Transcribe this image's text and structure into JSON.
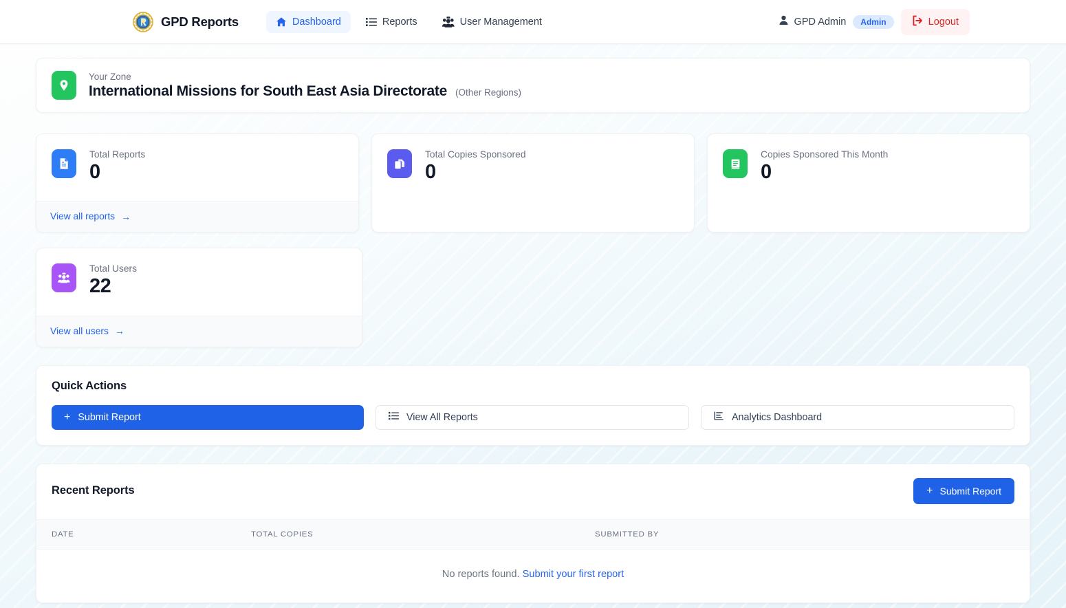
{
  "header": {
    "brand": "GPD Reports",
    "logo_icon": "gpd-emblem-logo",
    "nav": [
      {
        "label": "Dashboard",
        "icon": "home-icon",
        "active": true
      },
      {
        "label": "Reports",
        "icon": "list-icon",
        "active": false
      },
      {
        "label": "User Management",
        "icon": "users-icon",
        "active": false
      }
    ],
    "user_name": "GPD Admin",
    "user_icon": "person-icon",
    "role_badge": "Admin",
    "logout_label": "Logout",
    "logout_icon": "logout-icon"
  },
  "zone": {
    "icon": "map-pin-icon",
    "label": "Your Zone",
    "name": "International Missions for South East Asia Directorate",
    "region": "(Other Regions)"
  },
  "stats": [
    {
      "icon": "document-icon",
      "label": "Total Reports",
      "value": "0",
      "link": "View all reports",
      "link_arrow": "→",
      "has_footer": true,
      "color": "#2e7df6"
    },
    {
      "icon": "copies-icon",
      "label": "Total Copies Sponsored",
      "value": "0",
      "link": "",
      "has_footer": false,
      "color": "#5b5bf0"
    },
    {
      "icon": "book-icon",
      "label": "Copies Sponsored This Month",
      "value": "0",
      "link": "",
      "has_footer": false,
      "color": "#22c55e"
    },
    {
      "icon": "users-group-icon",
      "label": "Total Users",
      "value": "22",
      "link": "View all users",
      "link_arrow": "→",
      "has_footer": true,
      "color": "#a855f7"
    }
  ],
  "quick_actions": {
    "title": "Quick Actions",
    "buttons": [
      {
        "label": "Submit Report",
        "icon": "plus-icon",
        "style": "primary"
      },
      {
        "label": "View All Reports",
        "icon": "list-icon",
        "style": "secondary"
      },
      {
        "label": "Analytics Dashboard",
        "icon": "chart-icon",
        "style": "secondary"
      }
    ]
  },
  "recent_reports": {
    "title": "Recent Reports",
    "submit_label": "Submit Report",
    "submit_icon": "plus-icon",
    "columns": [
      "DATE",
      "TOTAL COPIES",
      "SUBMITTED BY"
    ],
    "rows": [],
    "empty_text": "No reports found.",
    "empty_link": "Submit your first report"
  },
  "colors": {
    "primary": "#1f62e8",
    "link": "#2563eb",
    "danger": "#dc2626",
    "green": "#22c55e",
    "purple": "#a855f7",
    "indigo": "#5b5bf0"
  }
}
